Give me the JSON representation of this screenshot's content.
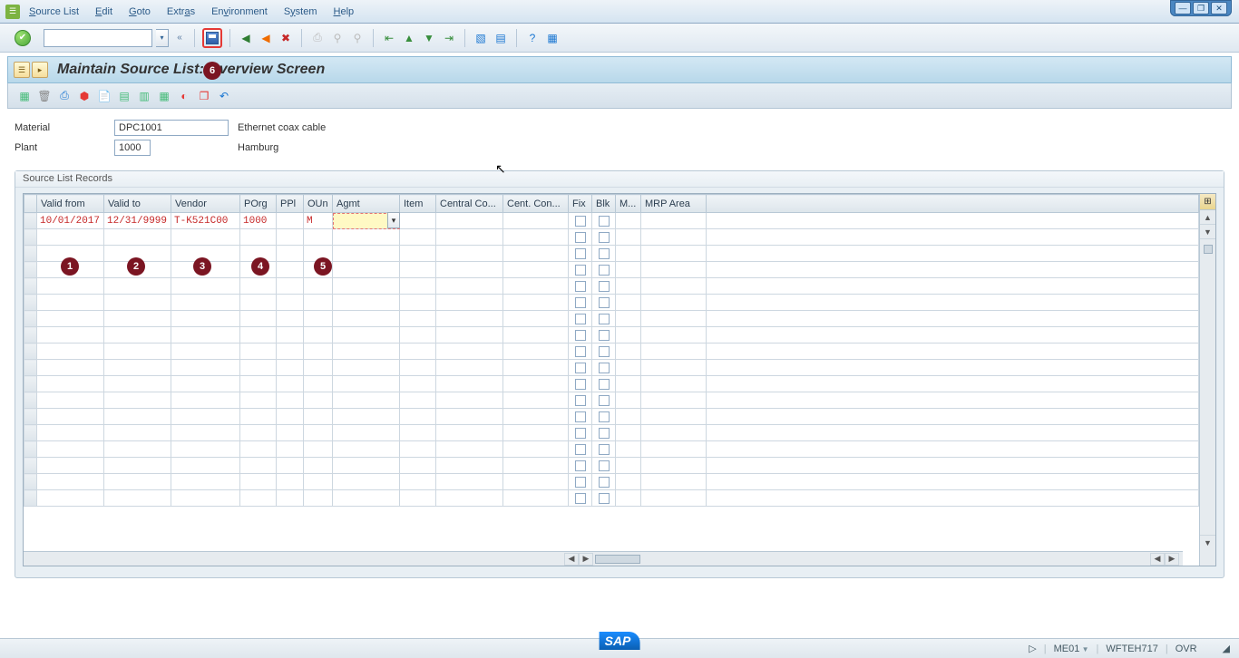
{
  "menu": {
    "items": [
      "Source List",
      "Edit",
      "Goto",
      "Extras",
      "Environment",
      "System",
      "Help"
    ]
  },
  "title": "Maintain Source List: Overview Screen",
  "header": {
    "material_label": "Material",
    "material_value": "DPC1001",
    "material_desc": "Ethernet coax cable",
    "plant_label": "Plant",
    "plant_value": "1000",
    "plant_desc": "Hamburg"
  },
  "group_title": "Source List Records",
  "columns": [
    "",
    "Valid from",
    "Valid to",
    "Vendor",
    "POrg",
    "PPl",
    "OUn",
    "Agmt",
    "Item",
    "Central Co...",
    "Cent. Con...",
    "Fix",
    "Blk",
    "M...",
    "MRP Area"
  ],
  "row1": {
    "valid_from": "10/01/2017",
    "valid_to": "12/31/9999",
    "vendor": "T-K521C00",
    "porg": "1000",
    "ppl": "",
    "oun": "M",
    "agmt": ""
  },
  "footer": {
    "tcode": "ME01",
    "server": "WFTEH717",
    "mode": "OVR"
  },
  "badges": [
    "1",
    "2",
    "3",
    "4",
    "5",
    "6"
  ]
}
